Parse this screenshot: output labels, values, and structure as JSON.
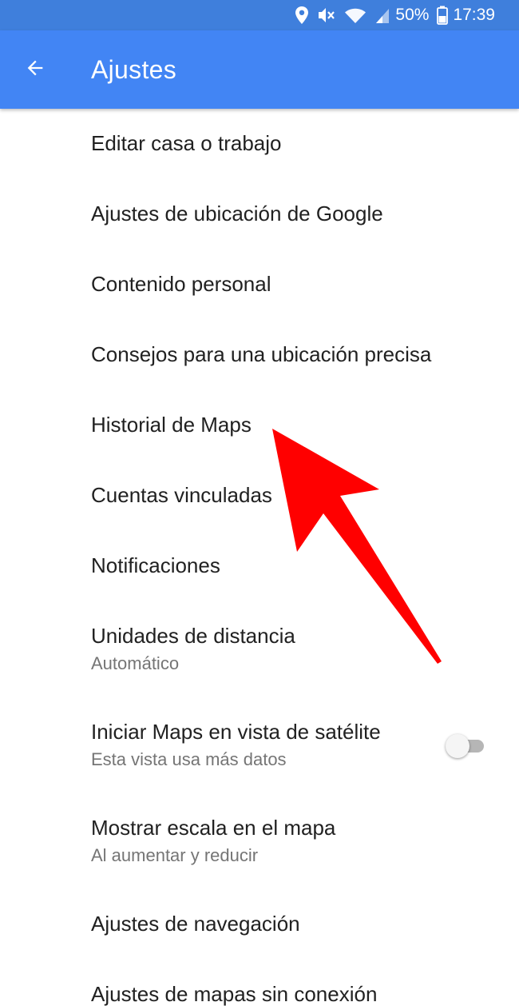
{
  "status_bar": {
    "battery": "50%",
    "time": "17:39",
    "icons": [
      "location-icon",
      "mute-icon",
      "wifi-icon",
      "signal-icon",
      "battery-icon"
    ]
  },
  "app_bar": {
    "title": "Ajustes",
    "back_icon": "arrow-back-icon"
  },
  "colors": {
    "status_bar": "#3f7fdc",
    "app_bar": "#4285f4",
    "annotation_arrow": "#ff0000"
  },
  "settings": [
    {
      "title": "Editar casa o trabajo"
    },
    {
      "title": "Ajustes de ubicación de Google"
    },
    {
      "title": "Contenido personal"
    },
    {
      "title": "Consejos para una ubicación precisa"
    },
    {
      "title": "Historial de Maps"
    },
    {
      "title": "Cuentas vinculadas"
    },
    {
      "title": "Notificaciones"
    },
    {
      "title": "Unidades de distancia",
      "subtitle": "Automático"
    },
    {
      "title": "Iniciar Maps en vista de satélite",
      "subtitle": "Esta vista usa más datos",
      "toggle_on": false
    },
    {
      "title": "Mostrar escala en el mapa",
      "subtitle": "Al aumentar y reducir"
    },
    {
      "title": "Ajustes de navegación"
    },
    {
      "title": "Ajustes de mapas sin conexión"
    }
  ]
}
